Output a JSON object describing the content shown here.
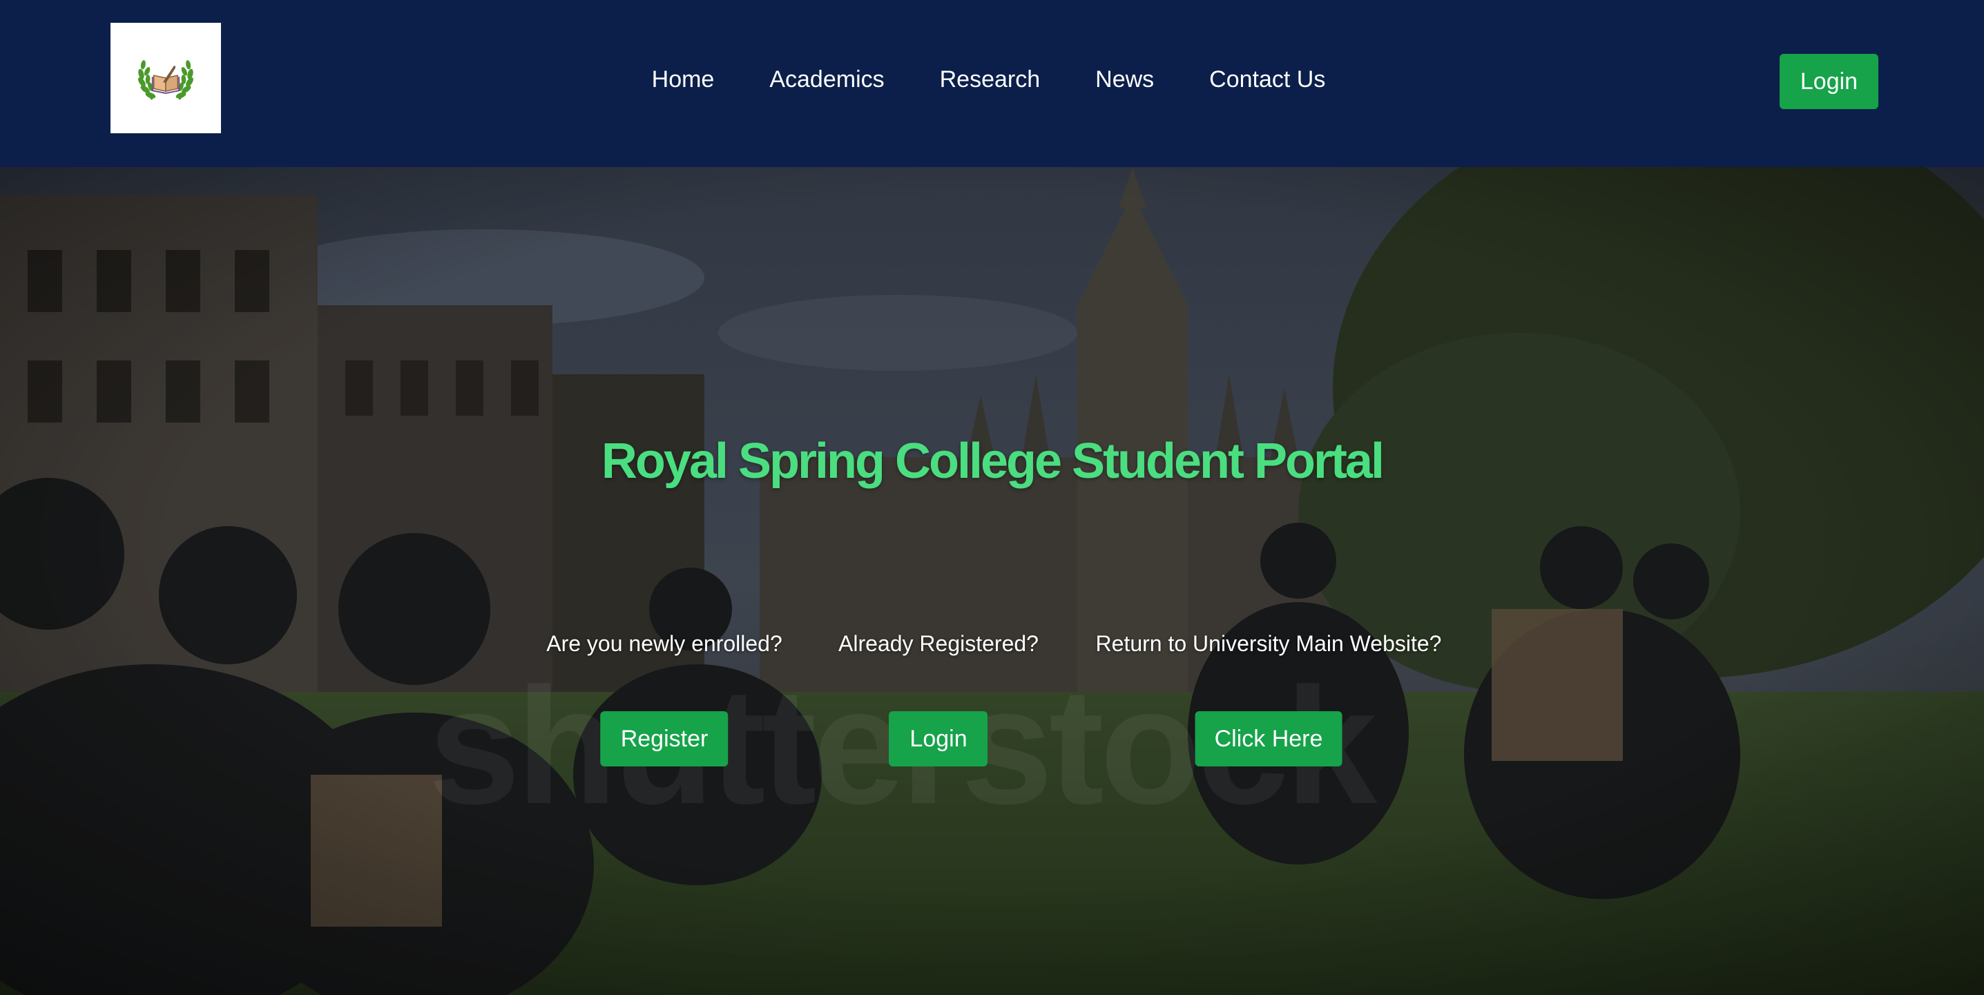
{
  "header": {
    "nav": [
      "Home",
      "Academics",
      "Research",
      "News",
      "Contact Us"
    ],
    "login_label": "Login"
  },
  "hero": {
    "title": "Royal Spring College Student Portal",
    "ctas": [
      {
        "question": "Are you newly enrolled?",
        "button": "Register"
      },
      {
        "question": "Already Registered?",
        "button": "Login"
      },
      {
        "question": "Return to University Main Website?",
        "button": "Click Here"
      }
    ],
    "watermark": "shutterstock"
  },
  "colors": {
    "header_bg": "#0b1f4a",
    "accent_green": "#16a34a",
    "title_green": "#4ade80"
  },
  "icons": {
    "logo": "laurel-wreath-book-icon"
  }
}
